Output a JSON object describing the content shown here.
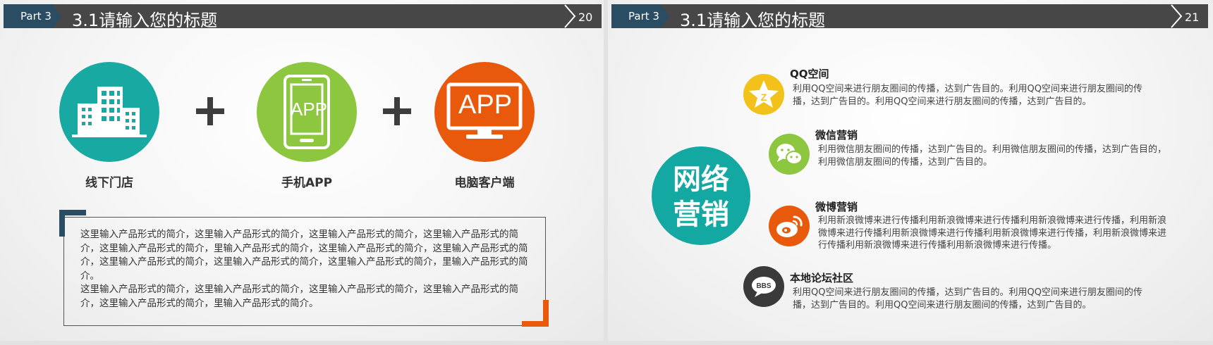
{
  "slides": [
    {
      "part": "Part 3",
      "title": "3.1请输入您的标题",
      "page_num": "20",
      "items": [
        {
          "label": "线下门店",
          "icon": "building-icon",
          "color": "#17a9a2"
        },
        {
          "label": "手机APP",
          "icon": "phone-app-icon",
          "icon_text": "APP",
          "color": "#8dc63f"
        },
        {
          "label": "电脑客户端",
          "icon": "monitor-app-icon",
          "icon_text": "APP",
          "color": "#e8590c"
        }
      ],
      "description": [
        "这里输入产品形式的简介，这里输入产品形式的简介，这里输入产品形式的简介，这里输入产品形式的简介，这里输入产品形式的简介，里输入产品形式的简介，这里输入产品形式的简介，这里输入产品形式的简介，这里输入产品形式的简介，这里输入产品形式的简介，这里输入产品形式的简介，里输入产品形式的简介。",
        "这里输入产品形式的简介，这里输入产品形式的简介，这里输入产品形式的简介，这里输入产品形式的简介，这里输入产品形式的简介，里输入产品形式的简介。"
      ]
    },
    {
      "part": "Part 3",
      "title": "3.1请输入您的标题",
      "page_num": "21",
      "center_label_line1": "网络",
      "center_label_line2": "营销",
      "features": [
        {
          "title": "QQ空间",
          "icon": "qzone-star-icon",
          "color": "#f2c21b",
          "body": "利用QQ空间来进行朋友圈间的传播，达到广告目的。利用QQ空间来进行朋友圈间的传播，达到广告目的。利用QQ空间来进行朋友圈间的传播，达到广告目的。"
        },
        {
          "title": "微信营销",
          "icon": "wechat-icon",
          "color": "#8dc63f",
          "body": "利用微信朋友圈间的传播，达到广告目的。利用微信朋友圈间的传播，达到广告目的，利用微信朋友圈间的传播，达到广告目的。"
        },
        {
          "title": "微博营销",
          "icon": "weibo-icon",
          "color": "#e8590c",
          "body": "利用新浪微博来进行传播利用新浪微博来进行传播利用新浪微博来进行传播，利用新浪微博来进行传播利用新浪微博来进行传播利用新浪微博来进行传播，利用新浪微博来进行传播利用新浪微博来进行传播利用新浪微博来进行传播。"
        },
        {
          "title": "本地论坛社区",
          "icon": "bbs-icon",
          "icon_text": "BBS",
          "color": "#3a3a3a",
          "body": "利用QQ空间来进行朋友圈间的传播，达到广告目的。利用QQ空间来进行朋友圈间的传播，达到广告目的。利用QQ空间来进行朋友圈间的传播，达到广告目的。"
        }
      ]
    }
  ],
  "colors": {
    "header_bar": "#474747",
    "part_tab": "#2b4d63",
    "accent_teal": "#17a9a2",
    "accent_orange": "#e8590c"
  }
}
